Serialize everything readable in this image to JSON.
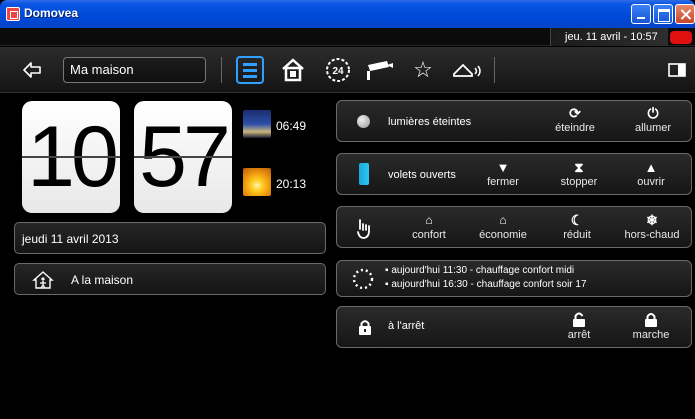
{
  "window": {
    "title": "Domovea"
  },
  "statusbar": {
    "datetime": "jeu. 11 avril - 10:57"
  },
  "toolbar": {
    "house_name": "Ma maison"
  },
  "clock": {
    "hours": "10",
    "minutes": "57",
    "sunrise": "06:49",
    "sunset": "20:13"
  },
  "date_panel": {
    "date": "jeudi 11 avril 2013"
  },
  "presence_panel": {
    "label": "A la maison"
  },
  "lights": {
    "status": "lumières éteintes",
    "off_label": "éteindre",
    "on_label": "allumer"
  },
  "shutters": {
    "status": "volets ouverts",
    "close_label": "fermer",
    "stop_label": "stopper",
    "open_label": "ouvrir"
  },
  "heating_modes": {
    "comfort": "confort",
    "eco": "économie",
    "reduced": "réduit",
    "frost": "hors-chaud"
  },
  "schedule": {
    "items": [
      "aujourd'hui 11:30 - chauffage confort midi",
      "aujourd'hui 16:30 - chauffage confort soir 17"
    ]
  },
  "alarm": {
    "status": "à l'arrêt",
    "stop_label": "arrêt",
    "start_label": "marche"
  }
}
